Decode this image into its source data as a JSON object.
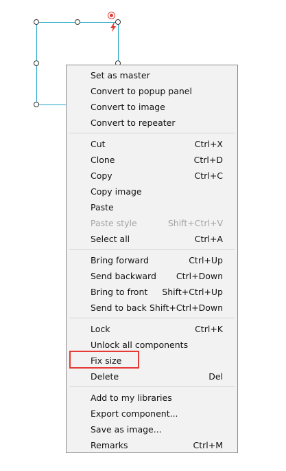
{
  "colors": {
    "selection_frame": "#1fa3c4",
    "highlight": "#e53935",
    "menu_background": "#f2f2f2",
    "disabled_text": "#a3a3a3"
  },
  "canvas": {
    "rotate_handle_icon": "rotate-icon",
    "interaction_icon": "lightning-icon"
  },
  "context_menu": {
    "groups": [
      [
        {
          "label": "Set as master",
          "shortcut": ""
        },
        {
          "label": "Convert to popup panel",
          "shortcut": ""
        },
        {
          "label": "Convert to image",
          "shortcut": ""
        },
        {
          "label": "Convert to repeater",
          "shortcut": ""
        }
      ],
      [
        {
          "label": "Cut",
          "shortcut": "Ctrl+X"
        },
        {
          "label": "Clone",
          "shortcut": "Ctrl+D"
        },
        {
          "label": "Copy",
          "shortcut": "Ctrl+C"
        },
        {
          "label": "Copy image",
          "shortcut": ""
        },
        {
          "label": "Paste",
          "shortcut": ""
        },
        {
          "label": "Paste style",
          "shortcut": "Shift+Ctrl+V",
          "disabled": true
        },
        {
          "label": "Select all",
          "shortcut": "Ctrl+A"
        }
      ],
      [
        {
          "label": "Bring forward",
          "shortcut": "Ctrl+Up"
        },
        {
          "label": "Send backward",
          "shortcut": "Ctrl+Down"
        },
        {
          "label": "Bring to front",
          "shortcut": "Shift+Ctrl+Up"
        },
        {
          "label": "Send to back",
          "shortcut": "Shift+Ctrl+Down"
        }
      ],
      [
        {
          "label": "Lock",
          "shortcut": "Ctrl+K"
        },
        {
          "label": "Unlock all components",
          "shortcut": ""
        },
        {
          "label": "Fix size",
          "shortcut": "",
          "highlighted": true
        },
        {
          "label": "Delete",
          "shortcut": "Del"
        }
      ],
      [
        {
          "label": "Add to my libraries",
          "shortcut": ""
        },
        {
          "label": "Export component...",
          "shortcut": ""
        },
        {
          "label": "Save as image...",
          "shortcut": ""
        },
        {
          "label": "Remarks",
          "shortcut": "Ctrl+M"
        }
      ]
    ]
  }
}
